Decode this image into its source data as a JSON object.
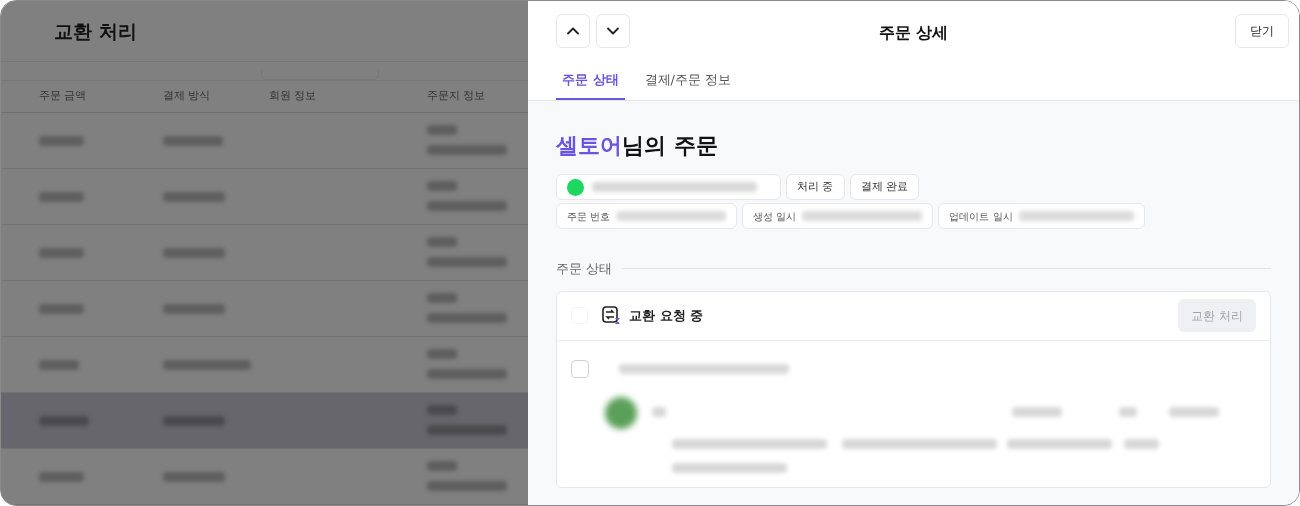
{
  "background_page": {
    "title": "교환 처리",
    "table": {
      "columns": [
        "주문 금액",
        "결제 방식",
        "회원 정보",
        "주문지 정보"
      ],
      "rows": [
        {
          "selected": false
        },
        {
          "selected": false
        },
        {
          "selected": false
        },
        {
          "selected": false
        },
        {
          "selected": false
        },
        {
          "selected": true
        },
        {
          "selected": false
        }
      ]
    }
  },
  "drawer": {
    "title": "주문 상세",
    "close_button": "닫기",
    "tabs": [
      {
        "label": "주문 상태",
        "selected": true
      },
      {
        "label": "결제/주문 정보",
        "selected": false
      }
    ],
    "customer_name": "셀토어",
    "heading_suffix": "님의 주문",
    "badges": [
      "처리 중",
      "결제 완료"
    ],
    "info_chips": [
      "주문 번호",
      "생성 일시",
      "업데이트 일시"
    ],
    "section_title": "주문 상태",
    "status_card": {
      "select_all": {
        "checked": false,
        "disabled": true
      },
      "status": "교환 요청 중",
      "action_button": {
        "label": "교환 처리",
        "disabled": true
      },
      "item": {
        "checked": false
      }
    }
  }
}
